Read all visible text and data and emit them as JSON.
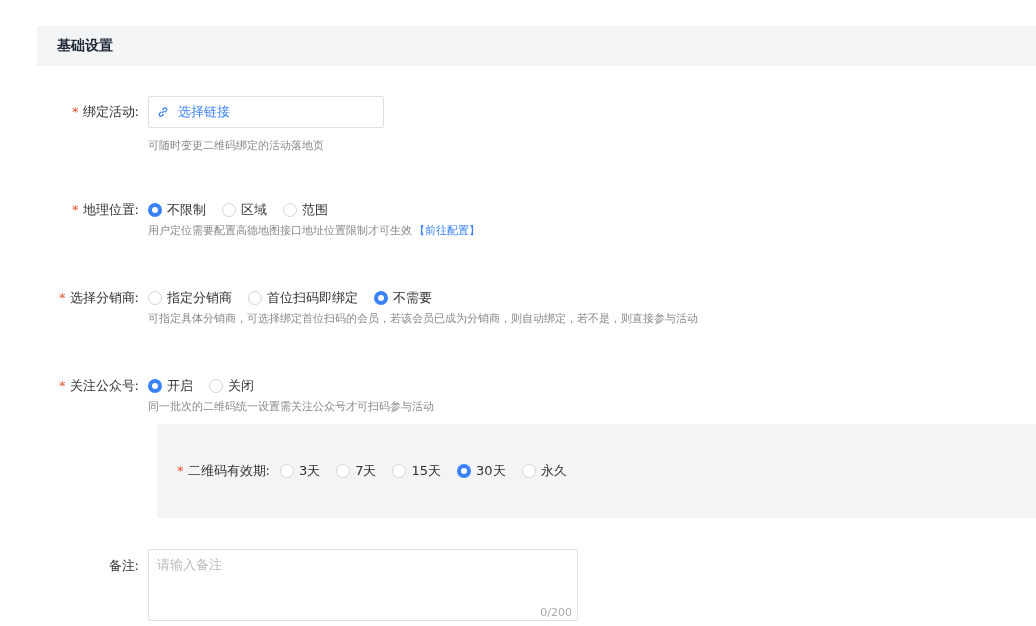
{
  "section": {
    "title": "基础设置"
  },
  "fields": [
    {
      "kind": "link",
      "marker": "*",
      "label": "绑定活动:",
      "button": "选择链接",
      "hint": "可随时变更二维码绑定的活动落地页"
    },
    {
      "kind": "radio",
      "marker": "*",
      "label": "地理位置:",
      "options": [
        {
          "label": "不限制",
          "selected": true
        },
        {
          "label": "区域",
          "selected": false
        },
        {
          "label": "范围",
          "selected": false
        }
      ],
      "hint": "用户定位需要配置高德地图接口地址位置限制才可生效",
      "hint_link": "【前往配置】"
    },
    {
      "kind": "radio",
      "marker": "*",
      "label": "选择分销商:",
      "options": [
        {
          "label": "指定分销商",
          "selected": false
        },
        {
          "label": "首位扫码即绑定",
          "selected": false
        },
        {
          "label": "不需要",
          "selected": true
        }
      ],
      "hint": "可指定具体分销商，可选择绑定首位扫码的会员，若该会员已成为分销商，则自动绑定，若不是，则直接参与活动"
    },
    {
      "kind": "radio",
      "marker": "*",
      "label": "关注公众号:",
      "options": [
        {
          "label": "开启",
          "selected": true
        },
        {
          "label": "关闭",
          "selected": false
        }
      ],
      "hint": "同一批次的二维码统一设置需关注公众号才可扫码参与活动"
    },
    {
      "kind": "panel",
      "marker": "*",
      "label": "二维码有效期:",
      "options": [
        {
          "label": "3天",
          "selected": false
        },
        {
          "label": "7天",
          "selected": false
        },
        {
          "label": "15天",
          "selected": false
        },
        {
          "label": "30天",
          "selected": true
        },
        {
          "label": "永久",
          "selected": false
        }
      ]
    },
    {
      "kind": "textarea",
      "label": "备注:",
      "placeholder": "请输入备注",
      "counter": "0/200"
    }
  ]
}
